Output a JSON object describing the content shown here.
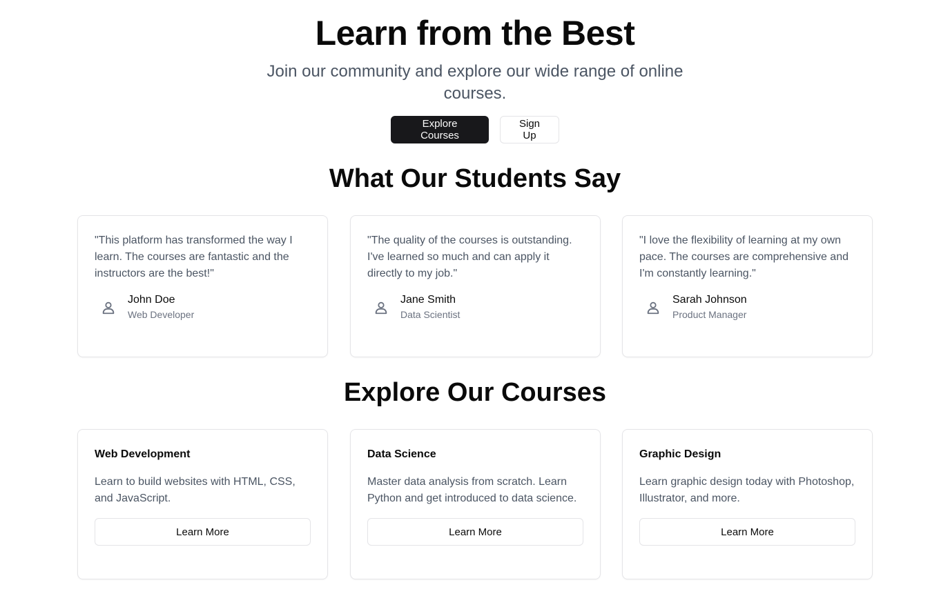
{
  "hero": {
    "title": "Learn from the Best",
    "subtitle": "Join our community and explore our wide range of online courses.",
    "primary_button": "Explore Courses",
    "secondary_button": "Sign Up"
  },
  "testimonials": {
    "heading": "What Our Students Say",
    "items": [
      {
        "quote": "\"This platform has transformed the way I learn. The courses are fantastic and the instructors are the best!\"",
        "name": "John Doe",
        "role": "Web Developer",
        "icon": "user-icon"
      },
      {
        "quote": "\"The quality of the courses is outstanding. I've learned so much and can apply it directly to my job.\"",
        "name": "Jane Smith",
        "role": "Data Scientist",
        "icon": "user-icon"
      },
      {
        "quote": "\"I love the flexibility of learning at my own pace. The courses are comprehensive and I'm constantly learning.\"",
        "name": "Sarah Johnson",
        "role": "Product Manager",
        "icon": "user-icon"
      }
    ]
  },
  "courses": {
    "heading": "Explore Our Courses",
    "items": [
      {
        "title": "Web Development",
        "description": "Learn to build websites with HTML, CSS, and JavaScript.",
        "button": "Learn More"
      },
      {
        "title": "Data Science",
        "description": "Master data analysis from scratch. Learn Python and get introduced to data science.",
        "button": "Learn More"
      },
      {
        "title": "Graphic Design",
        "description": "Learn graphic design today with Photoshop, Illustrator, and more.",
        "button": "Learn More"
      }
    ]
  },
  "colors": {
    "primary_button_bg": "#18181b",
    "muted_text": "#4b5563",
    "border": "#e4e4e7"
  }
}
